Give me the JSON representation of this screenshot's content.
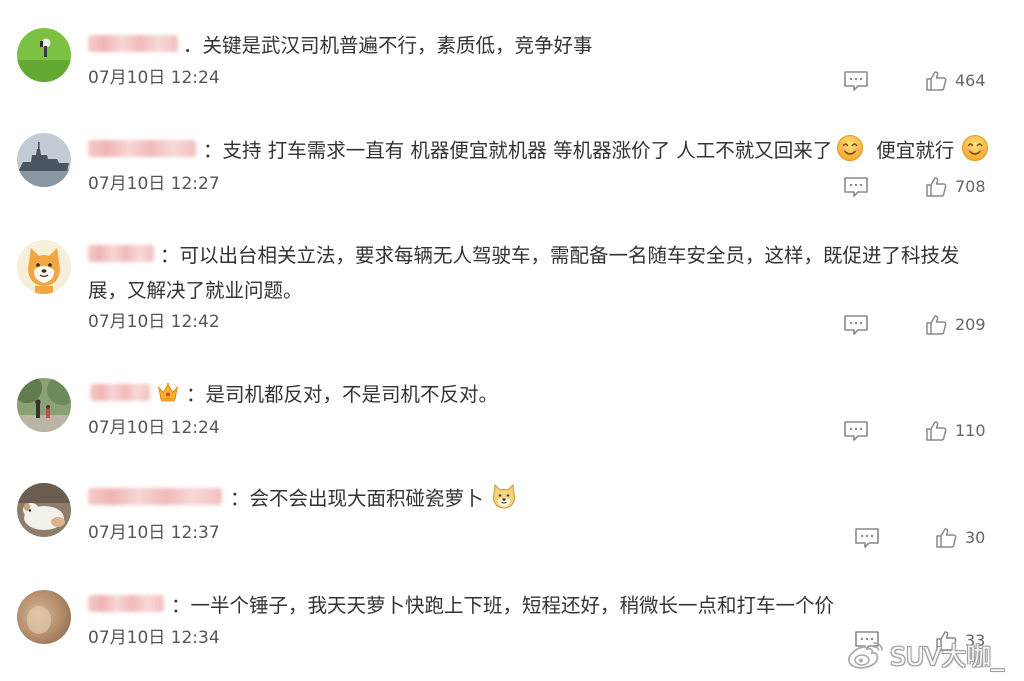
{
  "comments": [
    {
      "text": "．关键是武汉司机普遍不行，素质低，竞争好事",
      "date": "07月10日 12:24",
      "likes": "464"
    },
    {
      "text": "：支持 打车需求一直有 机器便宜就机器 等机器涨价了 人工不就又回来了",
      "emoji": "smile-emoji",
      "text_after": "便宜就行",
      "emoji_after": "smile-emoji",
      "date": "07月10日 12:27",
      "likes": "708"
    },
    {
      "text": "：可以出台相关立法，要求每辆无人驾驶车，需配备一名随车安全员，这样，既促进了科技发",
      "text_line2": "展，又解决了就业问题。",
      "date": "07月10日 12:42",
      "likes": "209"
    },
    {
      "badge": "crown-icon",
      "text": "：是司机都反对，不是司机不反对。",
      "date": "07月10日 12:24",
      "likes": "110"
    },
    {
      "text": "：会不会出现大面积碰瓷萝卜",
      "emoji": "doge-emoji",
      "date": "07月10日 12:37",
      "likes": "30"
    },
    {
      "text": "：一半个锤子，我天天萝卜快跑上下班，短程还好，稍微长一点和打车一个价",
      "date": "07月10日 12:34",
      "likes": "33"
    }
  ],
  "icons": {
    "reply": "comment-icon",
    "like": "thumbs-up-icon"
  },
  "watermark": {
    "icon": "weibo-logo-icon",
    "text": "SUV大咖_"
  },
  "colors": {
    "background": "#ffffff",
    "text": "#333333",
    "meta": "#555555",
    "icon": "#8a8a8a"
  }
}
